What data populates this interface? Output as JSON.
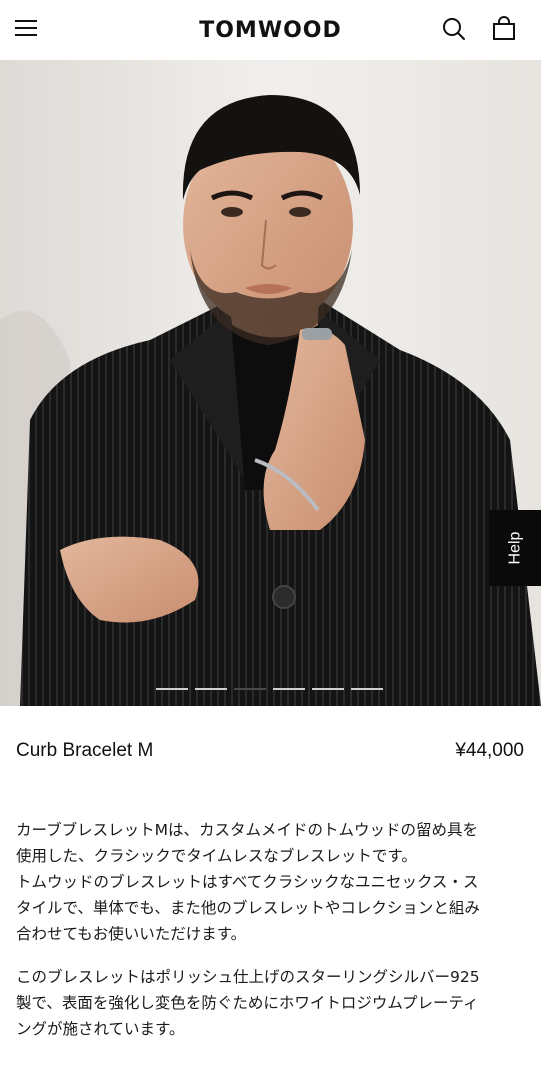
{
  "header": {
    "logo": "TOMWOOD",
    "menu_icon": "hamburger-menu-icon",
    "search_icon": "search-icon",
    "bag_icon": "shopping-bag-icon"
  },
  "hero": {
    "alt": "Model wearing black pleated jacket with Curb Bracelet M and ring",
    "slides_total": 6,
    "active_slide": 3
  },
  "help": {
    "label": "Help"
  },
  "product": {
    "name": "Curb Bracelet M",
    "price": "¥44,000"
  },
  "description": {
    "paragraph1_lines": [
      "カーブブレスレットMは、カスタムメイドのトムウッドの留め具を",
      "使用した、クラシックでタイムレスなブレスレットです。",
      "トムウッドのブレスレットはすべてクラシックなユニセックス・ス",
      "タイルで、単体でも、また他のブレスレットやコレクションと組み",
      "合わせてもお使いいただけます。"
    ],
    "paragraph2_lines": [
      "このブレスレットはポリッシュ仕上げのスターリングシルバー925",
      "製で、表面を強化し変色を防ぐためにホワイトロジウムプレーティ",
      "ングが施されています。"
    ]
  },
  "colors": {
    "background": "#ffffff",
    "text": "#111111",
    "help_bg": "#0a0a0a",
    "help_text": "#ffffff"
  }
}
